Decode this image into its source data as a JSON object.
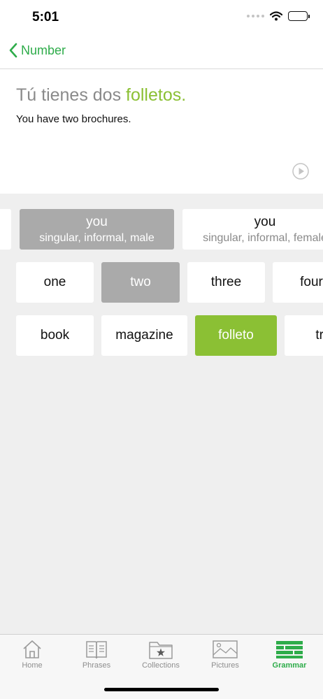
{
  "status_bar": {
    "time": "5:01"
  },
  "nav": {
    "back_label": "Number"
  },
  "phrase": {
    "sentence_plain": "Tú tienes dos ",
    "sentence_highlight": "folletos.",
    "translation": "You have two brochures."
  },
  "rows": {
    "pronoun": [
      {
        "label": "you",
        "sub": "singular, informal, male",
        "selected": true
      },
      {
        "label": "you",
        "sub": "singular, informal, female",
        "selected": false
      }
    ],
    "number": [
      {
        "label": "one",
        "selected": false
      },
      {
        "label": "two",
        "selected": true
      },
      {
        "label": "three",
        "selected": false
      },
      {
        "label": "four",
        "selected": false
      }
    ],
    "noun": [
      {
        "label": "book",
        "selected": false
      },
      {
        "label": "magazine",
        "selected": false
      },
      {
        "label": "folleto",
        "selected": true
      },
      {
        "label": "tra",
        "selected": false
      }
    ]
  },
  "tabbar": {
    "tabs": [
      {
        "label": "Home",
        "icon": "house-icon",
        "active": false
      },
      {
        "label": "Phrases",
        "icon": "book-icon",
        "active": false
      },
      {
        "label": "Collections",
        "icon": "folder-star-icon",
        "active": false
      },
      {
        "label": "Pictures",
        "icon": "picture-icon",
        "active": false
      },
      {
        "label": "Grammar",
        "icon": "grammar-bricks-icon",
        "active": true
      }
    ]
  },
  "colors": {
    "accent_green": "#2eac4a",
    "highlight_green": "#8bc034",
    "selected_gray": "#aaaaaa"
  }
}
